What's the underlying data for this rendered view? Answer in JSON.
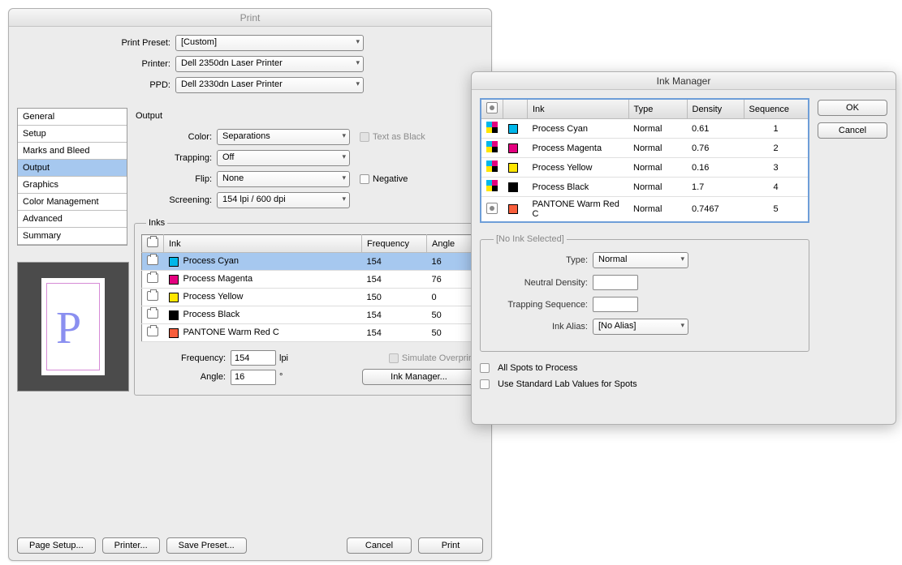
{
  "print_dialog": {
    "title": "Print",
    "preset_label": "Print Preset:",
    "preset_value": "[Custom]",
    "printer_label": "Printer:",
    "printer_value": "Dell 2350dn Laser Printer",
    "ppd_label": "PPD:",
    "ppd_value": "Dell 2330dn Laser Printer",
    "sidebar": [
      "General",
      "Setup",
      "Marks and Bleed",
      "Output",
      "Graphics",
      "Color Management",
      "Advanced",
      "Summary"
    ],
    "sidebar_selected": "Output",
    "section_title": "Output",
    "color_label": "Color:",
    "color_value": "Separations",
    "text_as_black_label": "Text as Black",
    "trapping_label": "Trapping:",
    "trapping_value": "Off",
    "flip_label": "Flip:",
    "flip_value": "None",
    "negative_label": "Negative",
    "screening_label": "Screening:",
    "screening_value": "154 lpi / 600 dpi",
    "inks_legend": "Inks",
    "inks_headers": {
      "ink": "Ink",
      "frequency": "Frequency",
      "angle": "Angle"
    },
    "inks_rows": [
      {
        "name": "Process Cyan",
        "frequency": "154",
        "angle": "16",
        "sw": "sw-cyan",
        "selected": true
      },
      {
        "name": "Process Magenta",
        "frequency": "154",
        "angle": "76",
        "sw": "sw-magenta",
        "selected": false
      },
      {
        "name": "Process Yellow",
        "frequency": "150",
        "angle": "0",
        "sw": "sw-yellow",
        "selected": false
      },
      {
        "name": "Process Black",
        "frequency": "154",
        "angle": "50",
        "sw": "sw-black",
        "selected": false
      },
      {
        "name": "PANTONE Warm Red C",
        "frequency": "154",
        "angle": "50",
        "sw": "sw-warmred",
        "selected": false
      }
    ],
    "frequency_label": "Frequency:",
    "frequency_value": "154",
    "frequency_unit": "lpi",
    "angle_label": "Angle:",
    "angle_value": "16",
    "angle_unit": "°",
    "simulate_overprint_label": "Simulate Overprint",
    "ink_manager_button": "Ink Manager...",
    "bottom_buttons": {
      "page_setup": "Page Setup...",
      "printer": "Printer...",
      "save_preset": "Save Preset...",
      "cancel": "Cancel",
      "print": "Print"
    }
  },
  "ink_manager": {
    "title": "Ink Manager",
    "ok": "OK",
    "cancel": "Cancel",
    "headers": {
      "ink": "Ink",
      "type": "Type",
      "density": "Density",
      "sequence": "Sequence"
    },
    "rows": [
      {
        "kind": "process",
        "sw": "sw-cyan",
        "name": "Process Cyan",
        "type": "Normal",
        "density": "0.61",
        "sequence": "1"
      },
      {
        "kind": "process",
        "sw": "sw-magenta",
        "name": "Process Magenta",
        "type": "Normal",
        "density": "0.76",
        "sequence": "2"
      },
      {
        "kind": "process",
        "sw": "sw-yellow",
        "name": "Process Yellow",
        "type": "Normal",
        "density": "0.16",
        "sequence": "3"
      },
      {
        "kind": "process",
        "sw": "sw-black",
        "name": "Process Black",
        "type": "Normal",
        "density": "1.7",
        "sequence": "4"
      },
      {
        "kind": "spot",
        "sw": "sw-warmred",
        "name": "PANTONE Warm Red C",
        "type": "Normal",
        "density": "0.7467",
        "sequence": "5"
      }
    ],
    "section_title": "[No Ink Selected]",
    "type_label": "Type:",
    "type_value": "Normal",
    "density_label": "Neutral Density:",
    "sequence_label": "Trapping Sequence:",
    "alias_label": "Ink Alias:",
    "alias_value": "[No Alias]",
    "all_spots_label": "All Spots to Process",
    "lab_values_label": "Use Standard Lab Values for Spots"
  }
}
